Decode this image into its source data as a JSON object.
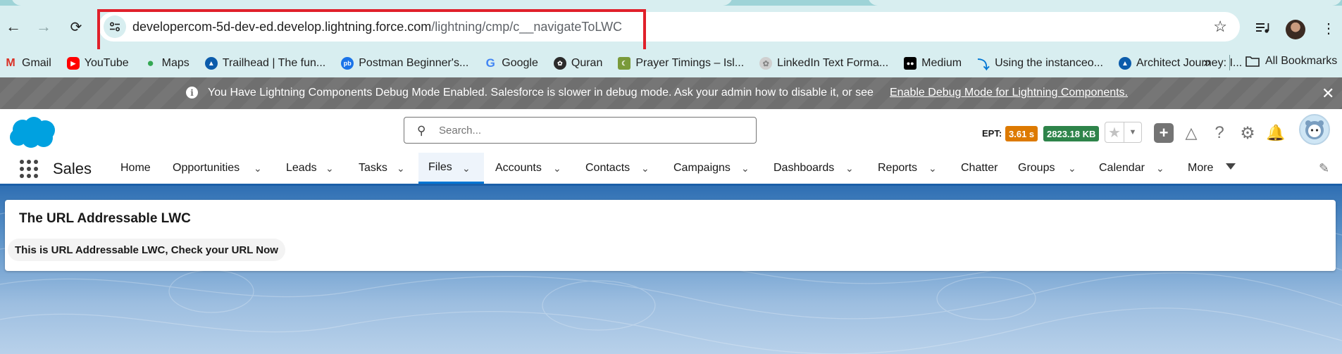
{
  "browser": {
    "url_host": "developercom-5d-dev-ed.develop.lightning.force.com",
    "url_path": "/lightning/cmp/c__navigateToLWC",
    "bookmarks": [
      {
        "label": "Gmail",
        "icon": "gmail-icon",
        "color": "#d93025"
      },
      {
        "label": "YouTube",
        "icon": "youtube-icon",
        "color": "#ff0000"
      },
      {
        "label": "Maps",
        "icon": "maps-icon",
        "color": "#34a853"
      },
      {
        "label": "Trailhead | The fun...",
        "icon": "trailhead-icon",
        "color": "#0b5cab"
      },
      {
        "label": "Postman Beginner's...",
        "icon": "postman-icon",
        "color": "#1a73e8"
      },
      {
        "label": "Google",
        "icon": "google-icon",
        "color": "#4285f4"
      },
      {
        "label": "Quran",
        "icon": "quran-icon",
        "color": "#2b2b2b"
      },
      {
        "label": "Prayer Timings – Isl...",
        "icon": "prayer-icon",
        "color": "#7a9a3a"
      },
      {
        "label": "LinkedIn Text Forma...",
        "icon": "linkedin-format-icon",
        "color": "#cfcfcf"
      },
      {
        "label": "Medium",
        "icon": "medium-icon",
        "color": "#000000"
      },
      {
        "label": "Using the instanceo...",
        "icon": "salesforce-dev-icon",
        "color": "#0176d3"
      },
      {
        "label": "Architect Journey: I...",
        "icon": "trailhead-icon",
        "color": "#0b5cab"
      }
    ],
    "all_bookmarks": "All Bookmarks"
  },
  "debug_banner": {
    "message": "You Have Lightning Components Debug Mode Enabled. Salesforce is slower in debug mode. Ask your admin how to disable it, or see",
    "link": "Enable Debug Mode for Lightning Components."
  },
  "header": {
    "search_placeholder": "Search...",
    "ept_label": "EPT:",
    "ept_value": "3.61 s",
    "memory_value": "2823.18 KB",
    "ept_color": "#dd7a01",
    "memory_color": "#2e844a"
  },
  "nav": {
    "app_name": "Sales",
    "items": [
      {
        "label": "Home",
        "dropdown": false
      },
      {
        "label": "Opportunities",
        "dropdown": true
      },
      {
        "label": "Leads",
        "dropdown": true
      },
      {
        "label": "Tasks",
        "dropdown": true
      },
      {
        "label": "Files",
        "dropdown": true,
        "active": true
      },
      {
        "label": "Accounts",
        "dropdown": true
      },
      {
        "label": "Contacts",
        "dropdown": true
      },
      {
        "label": "Campaigns",
        "dropdown": true
      },
      {
        "label": "Dashboards",
        "dropdown": true
      },
      {
        "label": "Reports",
        "dropdown": true
      },
      {
        "label": "Chatter",
        "dropdown": false
      },
      {
        "label": "Groups",
        "dropdown": true
      },
      {
        "label": "Calendar",
        "dropdown": true
      },
      {
        "label": "More",
        "dropdown": true
      }
    ]
  },
  "content": {
    "card_title": "The URL Addressable LWC",
    "card_message": "This is URL Addressable LWC, Check your URL Now"
  }
}
